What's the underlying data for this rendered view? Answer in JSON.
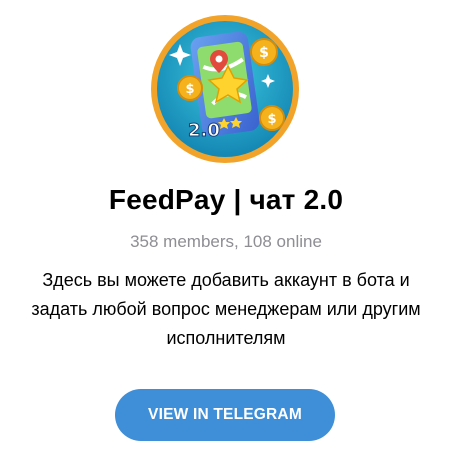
{
  "channel": {
    "title": "FeedPay | чат 2.0",
    "stats": "358 members, 108 online",
    "description": "Здесь вы можете добавить аккаунт в бота и задать любой вопрос менеджерам или другим исполнителям"
  },
  "avatar": {
    "icon": "phone-map-coins-icon",
    "badge_text": "2.0",
    "colors": {
      "ring": "#f2a32a",
      "background": "#1fa7c9",
      "phone": "#4d7de0",
      "map": "#7fd36a",
      "star": "#ffd32e",
      "coin": "#f6b21c",
      "pin": "#e24a3b"
    }
  },
  "actions": {
    "view_label": "VIEW IN TELEGRAM"
  },
  "colors": {
    "accent": "#3f8ed8",
    "secondary_text": "#8e8e93"
  }
}
